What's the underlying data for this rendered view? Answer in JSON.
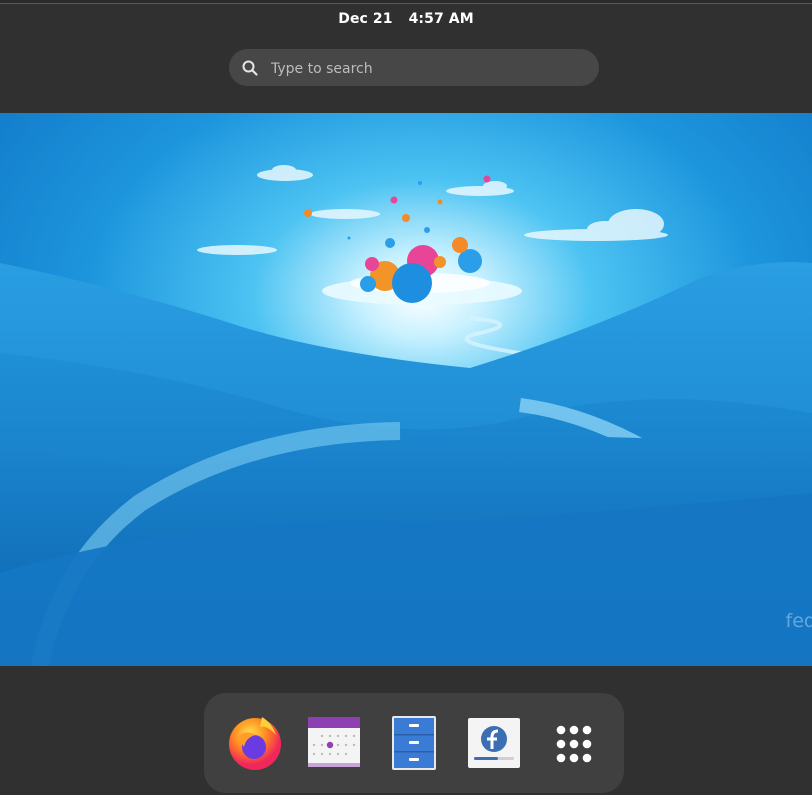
{
  "topbar": {
    "date": "Dec 21",
    "time": "4:57 AM"
  },
  "search": {
    "placeholder": "Type to search",
    "icon": "search-icon"
  },
  "wallpaper": {
    "watermark": "fed"
  },
  "dock": {
    "items": [
      {
        "name": "Firefox",
        "icon": "firefox-icon"
      },
      {
        "name": "Calendar",
        "icon": "calendar-icon"
      },
      {
        "name": "Files",
        "icon": "file-cabinet-icon"
      },
      {
        "name": "Fedora Media Writer",
        "icon": "fedora-media-writer-icon"
      },
      {
        "name": "Show Apps",
        "icon": "app-grid-icon"
      }
    ]
  },
  "colors": {
    "panel_bg": "#303030",
    "search_bg": "#474747",
    "dock_bg": "#404040",
    "calendar_accent": "#8e3fb2",
    "files_blue": "#3a7bd5",
    "sky": "#1f8ad0"
  }
}
